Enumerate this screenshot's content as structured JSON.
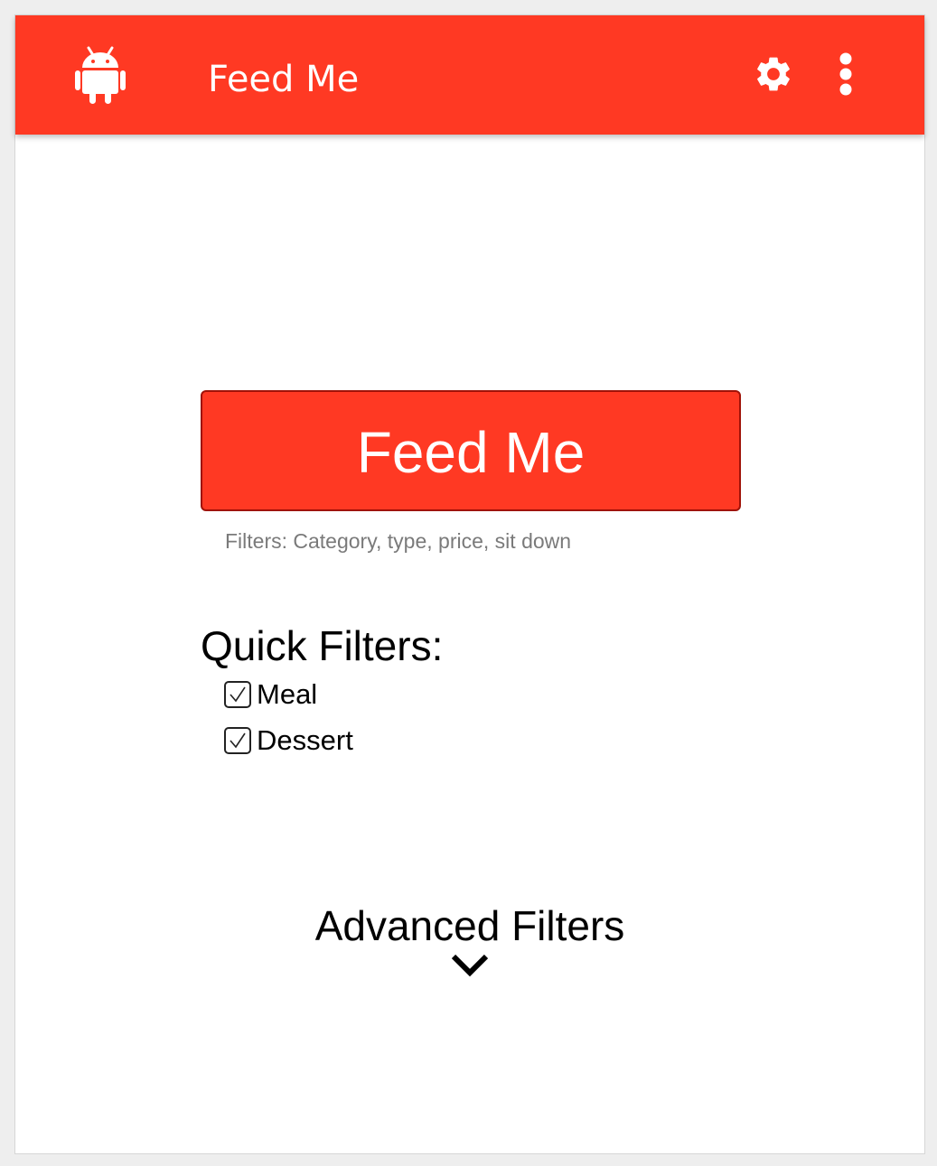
{
  "app_bar": {
    "title": "Feed Me",
    "background_color": "#ff3923",
    "icons": {
      "app": "android-icon",
      "settings": "gear-icon",
      "overflow": "more-vert-icon"
    }
  },
  "main": {
    "primary_button_label": "Feed Me",
    "primary_button_color": "#ff3923",
    "filters_caption": "Filters: Category, type, price, sit down",
    "quick_filters": {
      "title": "Quick Filters:",
      "items": [
        {
          "label": "Meal",
          "checked": true
        },
        {
          "label": "Dessert",
          "checked": true
        }
      ]
    },
    "advanced_filters": {
      "label": "Advanced Filters",
      "icon": "chevron-down-icon"
    }
  }
}
